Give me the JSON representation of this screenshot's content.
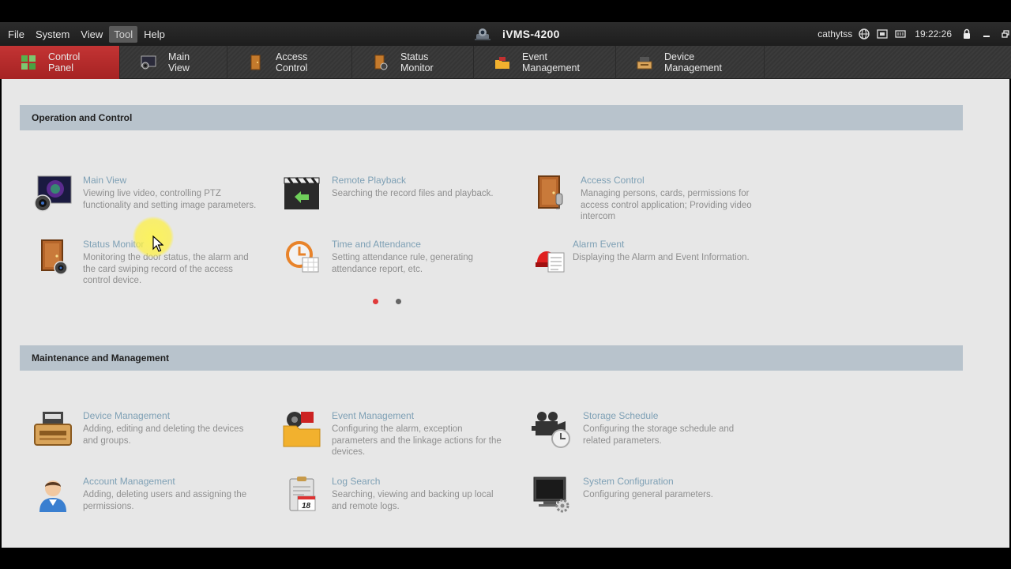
{
  "titlebar": {
    "menu": [
      "File",
      "System",
      "View",
      "Tool",
      "Help"
    ],
    "active_menu_index": 3,
    "app_title": "iVMS-4200",
    "user": "cathytss",
    "time": "19:22:26"
  },
  "tabs": [
    {
      "label": "Control Panel",
      "icon": "control-panel-icon",
      "active": true
    },
    {
      "label": "Main View",
      "icon": "main-view-icon",
      "active": false
    },
    {
      "label": "Access Control",
      "icon": "access-control-icon",
      "active": false
    },
    {
      "label": "Status Monitor",
      "icon": "status-monitor-icon",
      "active": false
    },
    {
      "label": "Event Management",
      "icon": "event-management-icon",
      "active": false
    },
    {
      "label": "Device Management",
      "icon": "device-management-icon",
      "active": false
    }
  ],
  "sections": {
    "operation": {
      "title": "Operation and Control",
      "modules": [
        {
          "title": "Main View",
          "desc": "Viewing live video, controlling PTZ functionality and setting image parameters.",
          "icon": "main-view-icon"
        },
        {
          "title": "Remote Playback",
          "desc": "Searching the record files and playback.",
          "icon": "remote-playback-icon"
        },
        {
          "title": "Access Control",
          "desc": "Managing persons, cards, permissions for access control application; Providing video intercom",
          "icon": "access-control-icon"
        },
        {
          "title": "Status Monitor",
          "desc": "Monitoring the door status, the alarm and the card swiping record of the access control device.",
          "icon": "status-monitor-icon"
        },
        {
          "title": "Time and Attendance",
          "desc": "Setting attendance rule, generating attendance report, etc.",
          "icon": "time-attendance-icon"
        },
        {
          "title": "Alarm Event",
          "desc": "Displaying the Alarm and Event Information.",
          "icon": "alarm-event-icon"
        }
      ]
    },
    "maintenance": {
      "title": "Maintenance and Management",
      "modules": [
        {
          "title": "Device Management",
          "desc": "Adding, editing and deleting the devices and groups.",
          "icon": "device-management-icon"
        },
        {
          "title": "Event Management",
          "desc": "Configuring the alarm, exception parameters and the linkage actions for the devices.",
          "icon": "event-management-icon"
        },
        {
          "title": "Storage Schedule",
          "desc": "Configuring the storage schedule and related parameters.",
          "icon": "storage-schedule-icon"
        },
        {
          "title": "Account Management",
          "desc": "Adding, deleting users and assigning the permissions.",
          "icon": "account-management-icon"
        },
        {
          "title": "Log Search",
          "desc": "Searching, viewing and backing up local and remote logs.",
          "icon": "log-search-icon"
        },
        {
          "title": "System Configuration",
          "desc": "Configuring general parameters.",
          "icon": "system-configuration-icon"
        }
      ]
    }
  },
  "pagination": {
    "pages": 2,
    "current": 1
  },
  "log_icon_day": "18",
  "colors": {
    "accent_red": "#c33434",
    "module_title": "#7ea0b5",
    "section_header": "#b8c3cc"
  }
}
